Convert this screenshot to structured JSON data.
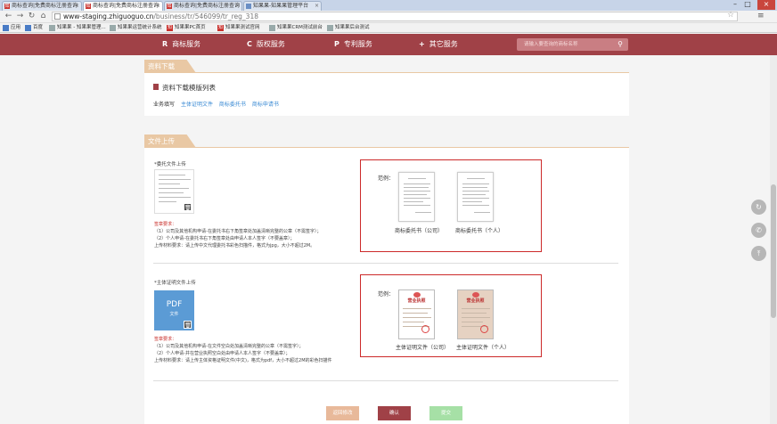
{
  "browser": {
    "tabs": [
      {
        "label": "商标查询|免费商标注册查询"
      },
      {
        "label": "商标查询|免费商标注册查询"
      },
      {
        "label": "商标查询|免费商标注册查询"
      },
      {
        "label": "知果果-知果果管理平台"
      }
    ],
    "url_host": "www-staging.zhiguoguo.cn",
    "url_path": "/business/tr/546099/tr_reg_318",
    "bookmarks": [
      {
        "label": "应用",
        "icon": "apps-grid-icon"
      },
      {
        "label": "百度",
        "icon": "baidu-icon"
      },
      {
        "label": "知果果 - 知果果管理...",
        "icon": "page-icon"
      },
      {
        "label": "知果果运营统计系统",
        "icon": "page-icon"
      },
      {
        "label": "知果果PC首页",
        "icon": "zhi-icon"
      },
      {
        "label": "知果果测试官网",
        "icon": "zhi-icon"
      },
      {
        "label": "知果果CRM测试前台",
        "icon": "page-icon"
      },
      {
        "label": "知果果后台测试",
        "icon": "page-icon"
      }
    ]
  },
  "site_nav": {
    "items": [
      {
        "glyph": "R",
        "label": "商标服务"
      },
      {
        "glyph": "C",
        "label": "版权服务"
      },
      {
        "glyph": "P",
        "label": "专利服务"
      },
      {
        "glyph": "+",
        "label": "其它服务"
      }
    ],
    "search_placeholder": "请输入要查询的商标名称",
    "brand_color": "#a04147"
  },
  "download_section": {
    "header": "资料下载",
    "title": "资料下载模版列表",
    "business_label": "业务填写",
    "links": [
      "主体证明文件",
      "商标委托书",
      "商标申请书"
    ]
  },
  "upload_section": {
    "header": "文件上传",
    "power_of_attorney": {
      "label": "*委托文件上传",
      "req_title": "签章要求：",
      "req_lines": [
        "（1）公司及其他机构申请-在委托书右下角签章处加盖清晰完整的公章（不需签字）；",
        "（2）个人申请-在委托书右下角签章处由申请人本人签字（不要盖章）；",
        "上传材料要求：请上传中文代理委托书彩色扫描件，格式为jpg，大小不超过2M。"
      ],
      "example_label": "范例：",
      "examples": [
        "商标委托书（公司）",
        "商标委托书（个人）"
      ]
    },
    "identity_doc": {
      "label": "*主体证明文件上传",
      "file_type": "PDF",
      "file_caption": "文件",
      "req_title": "签章要求：",
      "req_lines": [
        "（1）公司及其他机构申请-在文件空白处加盖清晰完整的公章（不需签字）；",
        "（2）个人申请-并在营业执照空白处由申请人本人签字（不要盖章）；",
        "上传材料要求：请上传主体资格证明文件(中文)，格式为pdf，大小不超过2M的彩色扫描件"
      ],
      "example_label": "范例：",
      "license_heading": "营业执照",
      "examples": [
        "主体证明文件（公司）",
        "主体证明文件（个人）"
      ]
    }
  },
  "actions": {
    "back_label": "返回修改",
    "confirm_label": "确认",
    "submit_label": "提交",
    "back_color": "#e8b99a",
    "confirm_color": "#a04147",
    "submit_color": "#a6e0a6"
  },
  "side_tools": [
    {
      "icon": "refresh-icon"
    },
    {
      "icon": "phone-icon"
    },
    {
      "icon": "back-to-top-icon"
    }
  ]
}
